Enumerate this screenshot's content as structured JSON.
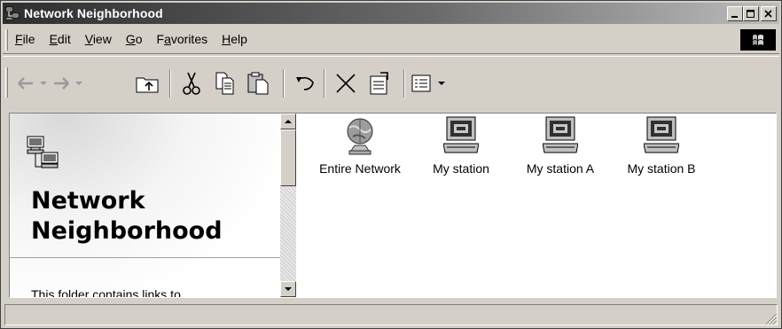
{
  "window": {
    "title": "Network Neighborhood",
    "buttons": [
      "minimize",
      "maximize",
      "close"
    ]
  },
  "menu": {
    "items": [
      {
        "label": "File",
        "mnemonic": "F"
      },
      {
        "label": "Edit",
        "mnemonic": "E"
      },
      {
        "label": "View",
        "mnemonic": "V"
      },
      {
        "label": "Go",
        "mnemonic": "G"
      },
      {
        "label": "Favorites",
        "mnemonic": "a"
      },
      {
        "label": "Help",
        "mnemonic": "H"
      }
    ]
  },
  "toolbar": {
    "buttons": [
      "back-icon",
      "forward-icon",
      "up-folder-icon",
      "cut-icon",
      "copy-icon",
      "paste-icon",
      "undo-icon",
      "delete-icon",
      "properties-icon",
      "views-icon"
    ]
  },
  "left_pane": {
    "title_line1": "Network",
    "title_line2": "Neighborhood",
    "description": "This folder contains links to"
  },
  "items": [
    {
      "label": "Entire Network",
      "icon": "globe-icon"
    },
    {
      "label": "My station",
      "icon": "computer-icon"
    },
    {
      "label": "My station A",
      "icon": "computer-icon"
    },
    {
      "label": "My station B",
      "icon": "computer-icon"
    }
  ],
  "status": {
    "text": ""
  },
  "colors": {
    "title_start": "#2e2e2e",
    "title_end": "#bdbdbd",
    "chrome": "#d4d0c8"
  }
}
